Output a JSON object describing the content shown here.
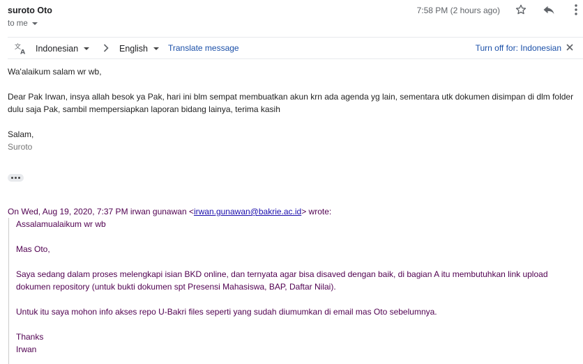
{
  "header": {
    "sender": "suroto Oto",
    "recipient": "to me",
    "time": "7:58 PM (2 hours ago)"
  },
  "icons": {
    "star": "star-outline-icon",
    "reply": "reply-arrow-icon",
    "more": "more-vert-icon",
    "translate": "translate-icon",
    "chevron": "chevron-right-icon",
    "close": "close-icon"
  },
  "translation_bar": {
    "source_language": "Indonesian",
    "target_language": "English",
    "translate_link": "Translate message",
    "turn_off_link": "Turn off for: Indonesian"
  },
  "message": {
    "greeting": "Wa'alaikum salam wr wb,",
    "paragraph": "Dear Pak Irwan, insya allah besok ya Pak, hari ini blm sempat membuatkan akun krn ada agenda yg lain, sementara utk dokumen disimpan di dlm folder dulu saja Pak, sambil mempersiapkan laporan bidang lainya, terima kasih",
    "closing": "Salam,",
    "signature": "Suroto"
  },
  "quoted": {
    "header_prefix": "On Wed, Aug 19, 2020, 7:37 PM irwan gunawan <",
    "email": "irwan.gunawan@bakrie.ac.id",
    "header_suffix": "> wrote:",
    "greeting": "Assalamualaikum wr wb",
    "salutation": "Mas Oto,",
    "paragraph1": "Saya sedang dalam proses melengkapi isian BKD online, dan ternyata agar bisa disaved dengan baik, di bagian A itu membutuhkan link upload dokumen repository (untuk bukti dokumen spt Presensi Mahasiswa, BAP, Daftar Nilai).",
    "paragraph2": "Untuk itu saya mohon info akses repo U-Bakri files seperti yang sudah diumumkan di email mas Oto sebelumnya.",
    "thanks": "Thanks",
    "signature": "Irwan"
  },
  "colors": {
    "link": "#1a4fa8",
    "quoted_text": "#500050",
    "muted": "#5f6368"
  }
}
